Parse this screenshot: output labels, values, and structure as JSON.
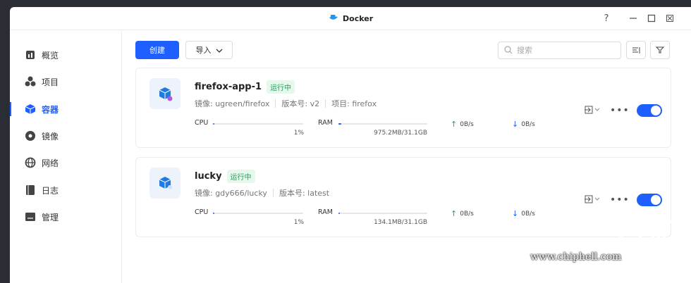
{
  "window": {
    "title": "Docker",
    "help": "?",
    "min": "—",
    "max": "☐",
    "close": "✕"
  },
  "sidebar": {
    "items": [
      {
        "label": "概览",
        "icon": "overview-icon"
      },
      {
        "label": "项目",
        "icon": "project-icon"
      },
      {
        "label": "容器",
        "icon": "container-icon",
        "active": true
      },
      {
        "label": "镜像",
        "icon": "image-icon"
      },
      {
        "label": "网络",
        "icon": "network-icon"
      },
      {
        "label": "日志",
        "icon": "log-icon"
      },
      {
        "label": "管理",
        "icon": "manage-icon"
      }
    ]
  },
  "toolbar": {
    "create_label": "创建",
    "import_label": "导入",
    "search_placeholder": "搜索"
  },
  "containers": [
    {
      "name": "firefox-app-1",
      "status": "运行中",
      "image": "镜像: ugreen/firefox",
      "version": "版本号: v2",
      "project": "项目: firefox",
      "cpu_label": "CPU",
      "cpu_value": "1%",
      "cpu_fraction": 0.01,
      "ram_label": "RAM",
      "ram_value": "975.2MB/31.1GB",
      "ram_fraction": 0.03,
      "up": "0B/s",
      "down": "0B/s"
    },
    {
      "name": "lucky",
      "status": "运行中",
      "image": "镜像: gdy666/lucky",
      "version": "版本号: latest",
      "cpu_label": "CPU",
      "cpu_value": "1%",
      "cpu_fraction": 0.01,
      "ram_label": "RAM",
      "ram_value": "134.1MB/31.1GB",
      "ram_fraction": 0.004,
      "up": "0B/s",
      "down": "0B/s"
    }
  ],
  "watermark": {
    "text": "www.chiphell.com"
  },
  "colors": {
    "accent": "#1f5fff",
    "running": "#22a35a"
  }
}
